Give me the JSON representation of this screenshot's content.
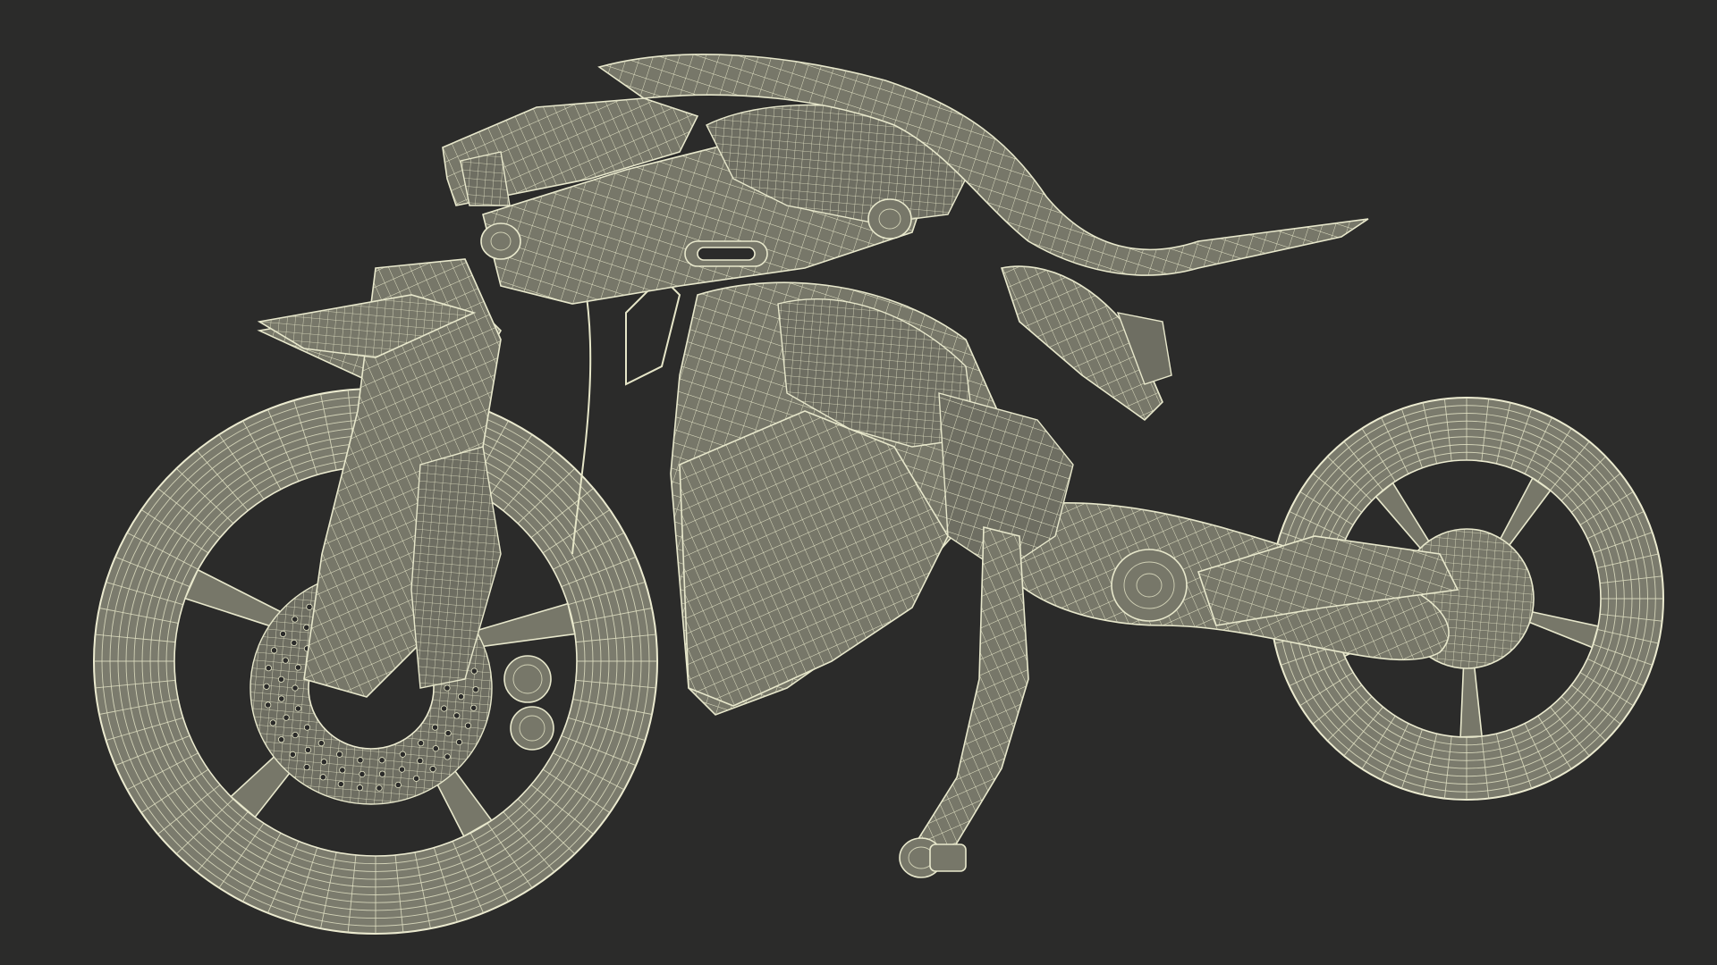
{
  "scene": {
    "subject": "motorcycle",
    "render_style": "wireframe-over-shaded",
    "colors": {
      "background": "#2b2b2a",
      "surface": "#777769",
      "wire": "#e6e6c8"
    },
    "front_wheel": {
      "spokes": 5,
      "mesh_rings": 10,
      "mesh_radials": 64
    },
    "rear_wheel": {
      "spokes": 5,
      "mesh_rings": 8,
      "mesh_radials": 56
    }
  }
}
